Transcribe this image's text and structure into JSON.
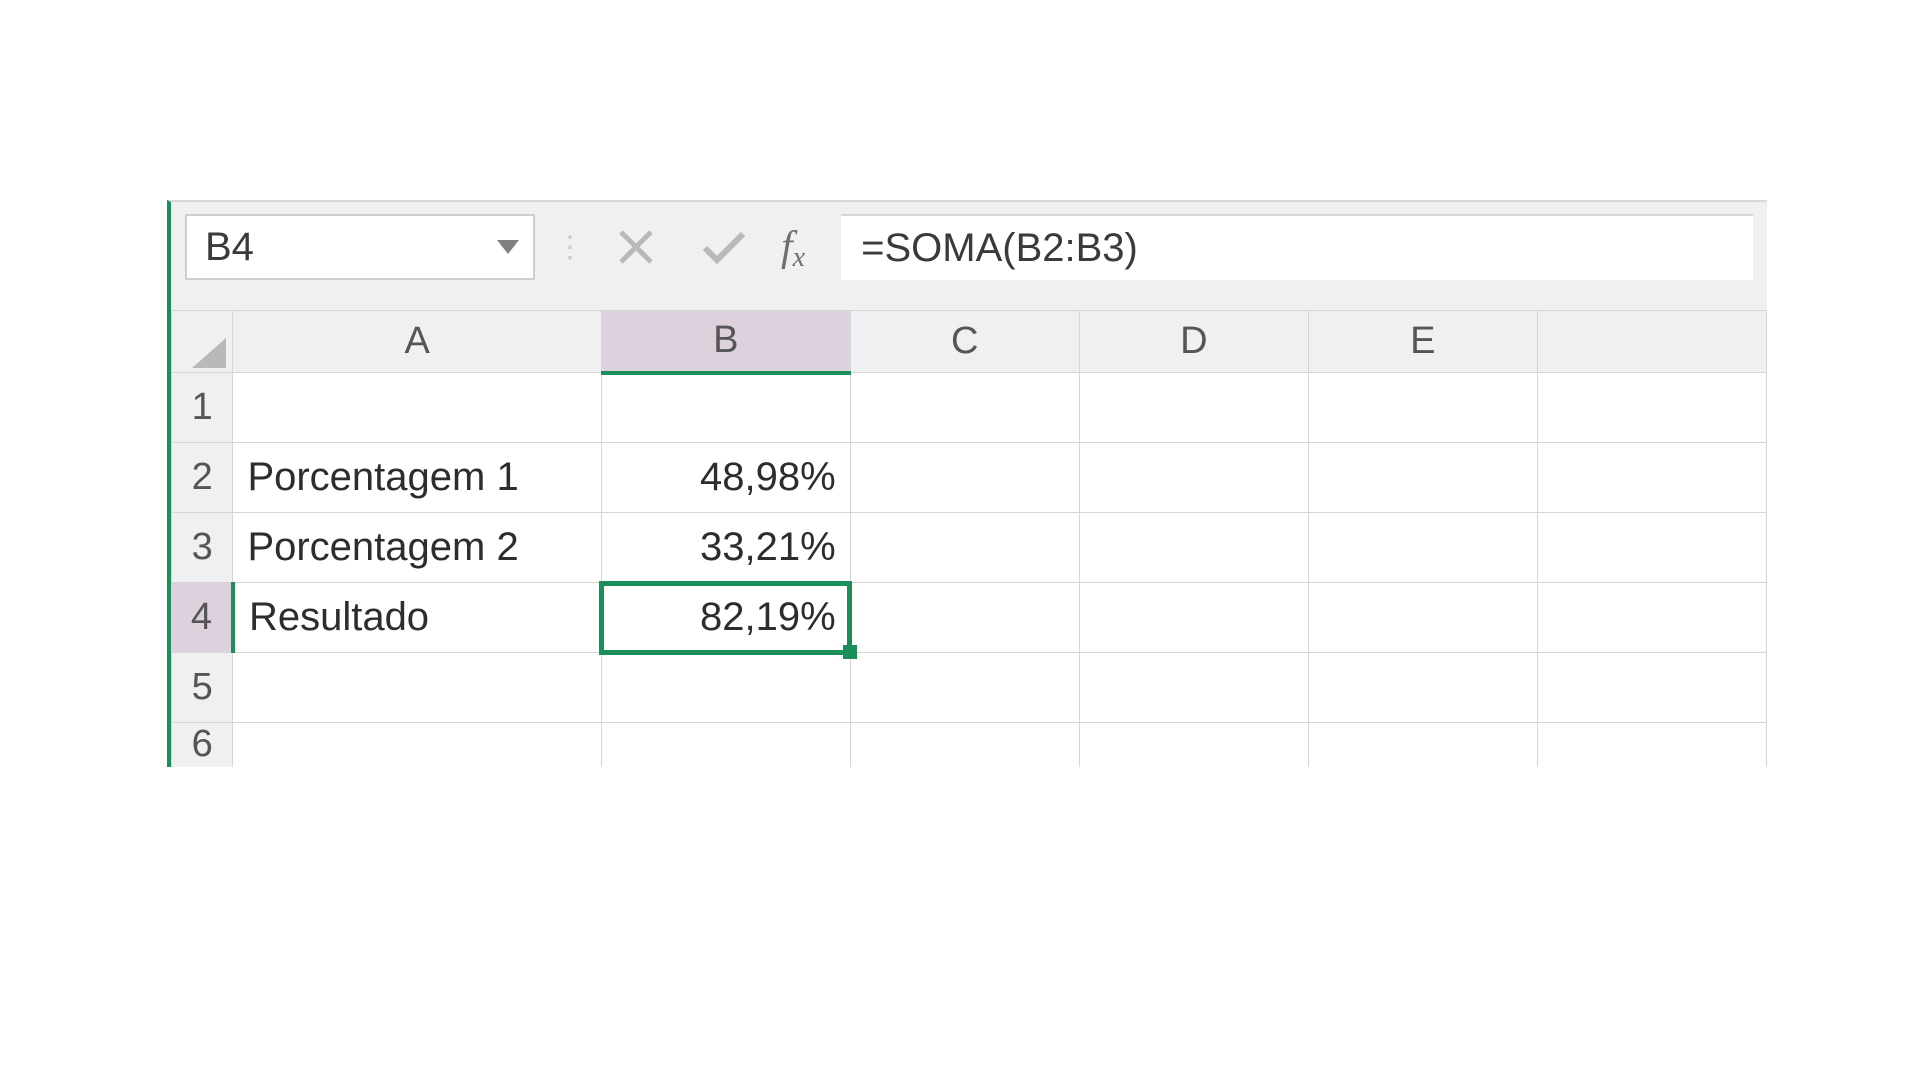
{
  "formula_bar": {
    "name_box": "B4",
    "formula": "=SOMA(B2:B3)"
  },
  "columns": [
    "A",
    "B",
    "C",
    "D",
    "E"
  ],
  "active_column": "B",
  "active_row": "4",
  "rows": [
    {
      "num": "1",
      "A": "",
      "B": ""
    },
    {
      "num": "2",
      "A": "Porcentagem 1",
      "B": "48,98%"
    },
    {
      "num": "3",
      "A": "Porcentagem 2",
      "B": "33,21%"
    },
    {
      "num": "4",
      "A": "Resultado",
      "B": "82,19%"
    },
    {
      "num": "5",
      "A": "",
      "B": ""
    },
    {
      "num": "6",
      "A": "",
      "B": ""
    }
  ]
}
